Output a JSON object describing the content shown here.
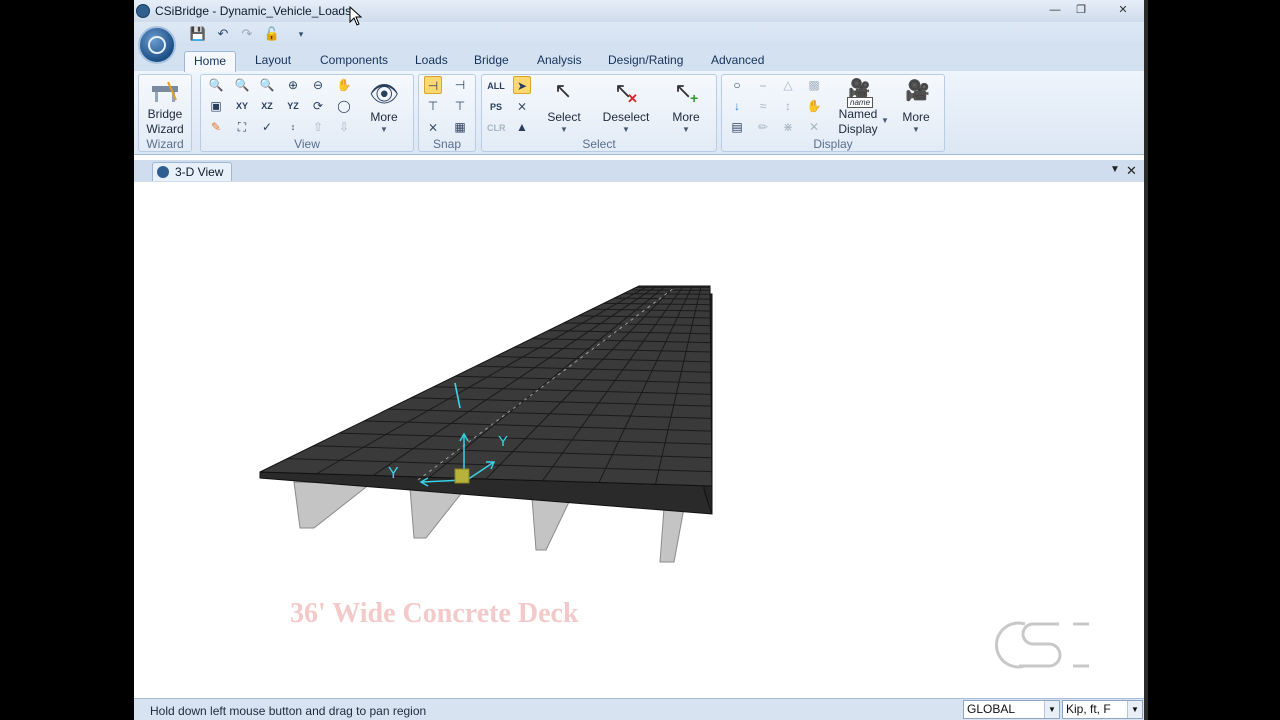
{
  "window": {
    "title": "CSiBridge - Dynamic_Vehicle_Loads"
  },
  "ribbon_tabs": [
    "Home",
    "Layout",
    "Components",
    "Loads",
    "Bridge",
    "Analysis",
    "Design/Rating",
    "Advanced"
  ],
  "groups": {
    "wizard": {
      "label": "Wizard",
      "button_line1": "Bridge",
      "button_line2": "Wizard"
    },
    "view": {
      "label": "View",
      "xy": "XY",
      "xz": "XZ",
      "yz": "YZ",
      "more": "More"
    },
    "snap": {
      "label": "Snap"
    },
    "select": {
      "label": "Select",
      "all": "ALL",
      "ps": "PS",
      "clr": "CLR",
      "select": "Select",
      "deselect": "Deselect",
      "more": "More"
    },
    "display": {
      "label": "Display",
      "named_line1": "Named",
      "named_line2": "Display",
      "name_tag": "name",
      "more": "More"
    }
  },
  "doc_tab": {
    "label": "3-D View"
  },
  "viewport": {
    "caption": "36' Wide Concrete Deck",
    "axis_y1": "Y",
    "axis_y2": "Y",
    "deck_color": "#3a3a3a",
    "girder_color": "#c4c4c4",
    "axis_color": "#3ad2e6"
  },
  "status": {
    "message": "Hold down left mouse button and drag to pan region",
    "coord_system": "GLOBAL",
    "units": "Kip, ft, F"
  }
}
